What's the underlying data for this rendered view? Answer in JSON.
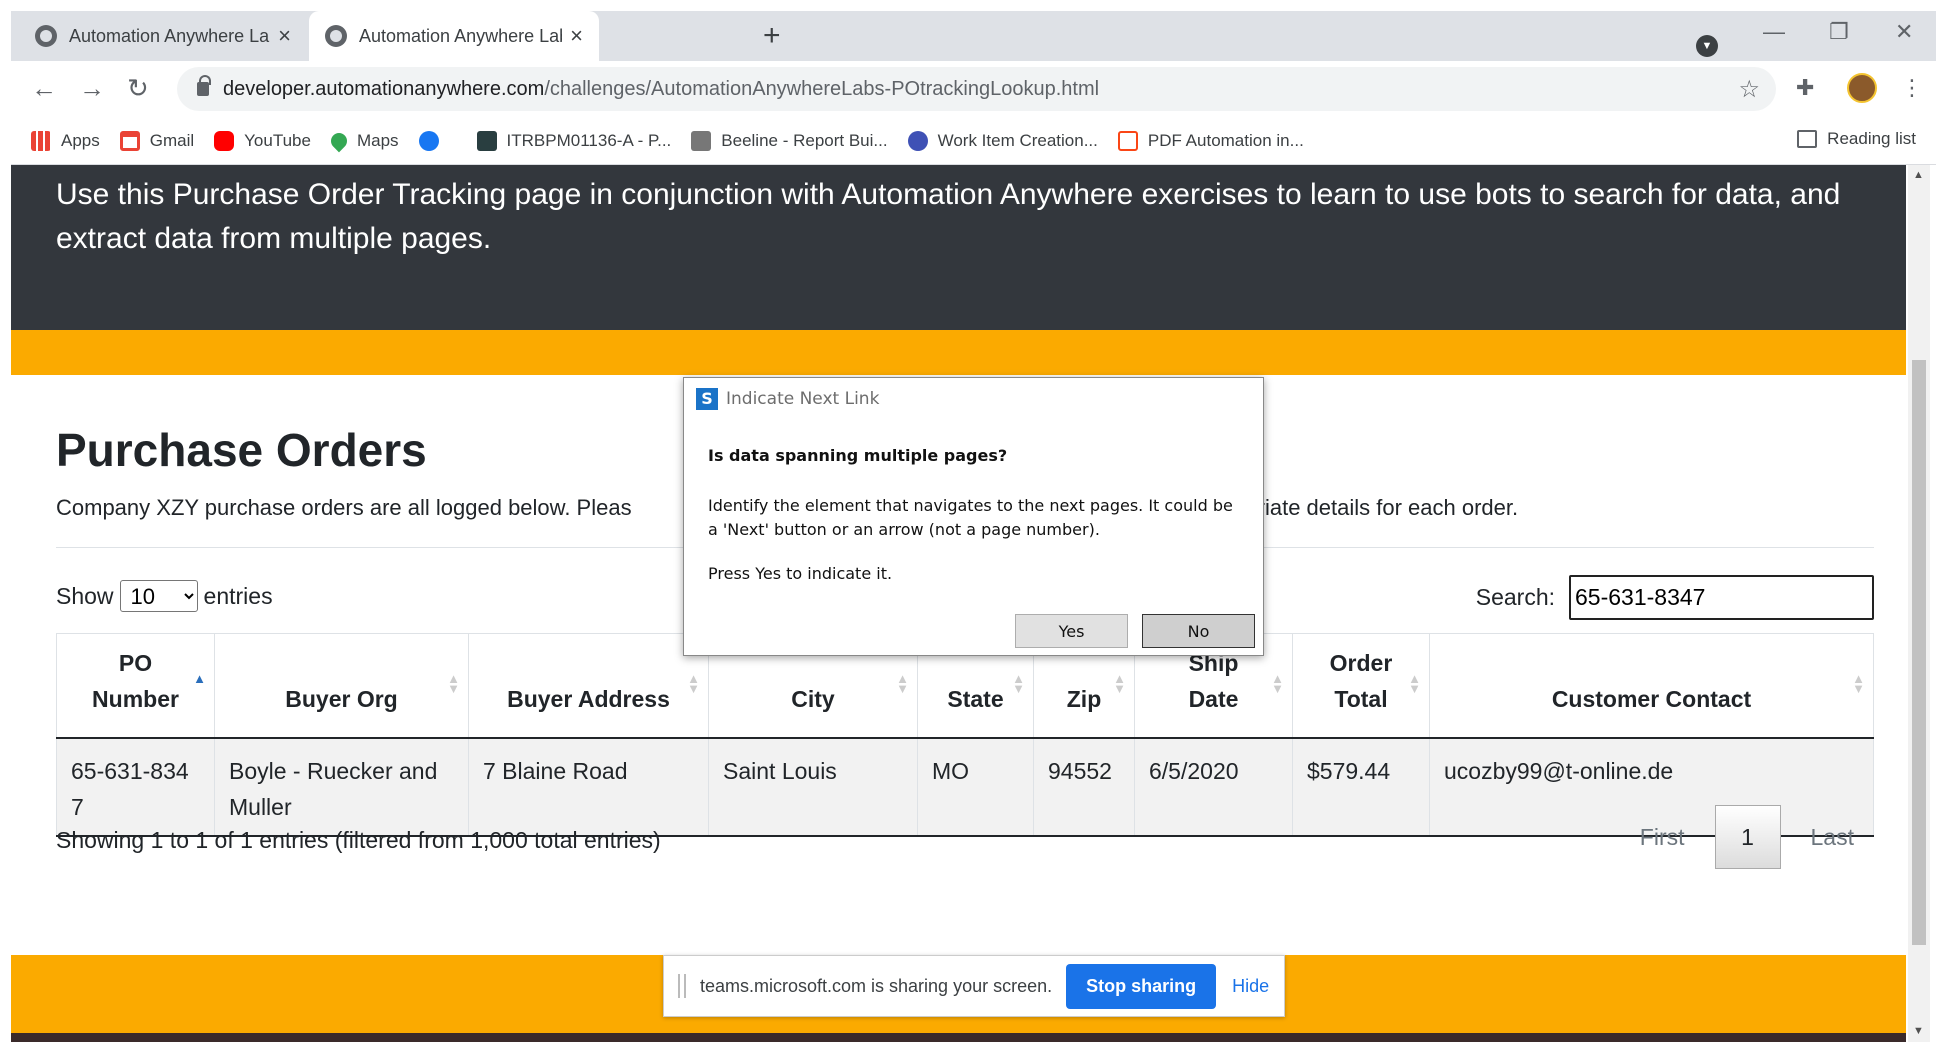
{
  "browser": {
    "tabs": [
      {
        "title": "Automation Anywhere Labs - Sup"
      },
      {
        "title": "Automation Anywhere Labs - PO"
      }
    ],
    "url_host": "developer.automationanywhere.com",
    "url_path": "/challenges/AutomationAnywhereLabs-POtrackingLookup.html",
    "bookmarks": [
      {
        "label": "Apps",
        "icon": "apps-grid-icon",
        "color": "#4285f4"
      },
      {
        "label": "Gmail",
        "icon": "gmail-icon",
        "color": "#ea4335"
      },
      {
        "label": "YouTube",
        "icon": "youtube-icon",
        "color": "#ff0000"
      },
      {
        "label": "Maps",
        "icon": "maps-pin-icon",
        "color": "#34a853"
      },
      {
        "label": "",
        "icon": "facebook-icon",
        "color": "#1877f2"
      },
      {
        "label": "ITRBPM01136-A - P...",
        "icon": "servicenow-icon",
        "color": "#293e40"
      },
      {
        "label": "Beeline - Report Bui...",
        "icon": "beeline-icon",
        "color": "#777777"
      },
      {
        "label": "Work Item Creation...",
        "icon": "work-item-icon",
        "color": "#3f51b5"
      },
      {
        "label": "PDF Automation in...",
        "icon": "uipath-icon",
        "color": "#fa4616"
      }
    ],
    "reading_list": "Reading list"
  },
  "page": {
    "hero_text": "Use this Purchase Order Tracking page in conjunction with Automation Anywhere exercises to learn to use bots to search for data, and extract data from multiple pages.",
    "heading": "Purchase Orders",
    "intro_left": "Company XZY purchase orders are all logged below. Pleas",
    "intro_right": "propriate details for each order.",
    "show_label": "Show",
    "entries_label": "entries",
    "page_size": "10",
    "search_label": "Search:",
    "search_value": "65-631-8347",
    "table": {
      "columns": [
        {
          "line1": "PO",
          "line2": "Number"
        },
        {
          "line1": "",
          "line2": "Buyer Org"
        },
        {
          "line1": "",
          "line2": "Buyer Address"
        },
        {
          "line1": "",
          "line2": "City"
        },
        {
          "line1": "",
          "line2": "State"
        },
        {
          "line1": "",
          "line2": "Zip"
        },
        {
          "line1": "Ship",
          "line2": "Date"
        },
        {
          "line1": "Order",
          "line2": "Total"
        },
        {
          "line1": "",
          "line2": "Customer Contact"
        }
      ],
      "rows": [
        [
          "65-631-8347",
          "Boyle - Ruecker and Muller",
          "7 Blaine Road",
          "Saint Louis",
          "MO",
          "94552",
          "6/5/2020",
          "$579.44",
          "ucozby99@t-online.de"
        ]
      ]
    },
    "info": "Showing 1 to 1 of 1 entries (filtered from 1,000 total entries)",
    "pager": {
      "first": "First",
      "current": "1",
      "last": "Last"
    }
  },
  "dialog": {
    "title": "Indicate Next Link",
    "question": "Is data spanning multiple pages?",
    "body": "Identify the element that navigates to the next pages. It could be a 'Next' button or an arrow (not a page number).",
    "press": "Press Yes to indicate it.",
    "yes": "Yes",
    "no": "No"
  },
  "share_bar": {
    "message": "teams.microsoft.com is sharing your screen.",
    "stop": "Stop sharing",
    "hide": "Hide"
  },
  "colors": {
    "accent_orange": "#fbaa00",
    "hero_dark": "#33373d",
    "link_blue": "#1a73e8"
  }
}
